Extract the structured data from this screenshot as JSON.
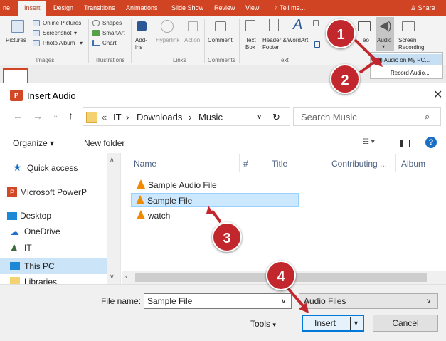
{
  "ribbon": {
    "tabs": [
      "ne",
      "Insert",
      "Design",
      "Transitions",
      "Animations",
      "Slide Show",
      "Review",
      "View",
      "Tell me...",
      "Share"
    ],
    "images": {
      "pictures": "Pictures",
      "online_pictures": "Online Pictures",
      "screenshot": "Screenshot",
      "photo_album": "Photo Album",
      "group": "Images"
    },
    "illustrations": {
      "shapes": "Shapes",
      "smartart": "SmartArt",
      "chart": "Chart",
      "group": "Illustrations"
    },
    "addins": {
      "label": "Add-ins"
    },
    "links": {
      "hyperlink": "Hyperlink",
      "action": "Action",
      "group": "Links"
    },
    "comments": {
      "comment": "Comment",
      "group": "Comments"
    },
    "text": {
      "text_box": "Text Box",
      "header_footer": "Header & Footer",
      "wordart": "WordArt",
      "group": "Text"
    },
    "media": {
      "video": "eo",
      "audio": "Audio",
      "screen_recording": "Screen Recording"
    },
    "audio_menu": {
      "on_pc": "Audio on My PC...",
      "record": "Record Audio..."
    }
  },
  "badges": [
    "1",
    "2",
    "3",
    "4"
  ],
  "dialog": {
    "title": "Insert Audio",
    "app_icon": "P",
    "breadcrumb": [
      "«",
      "IT",
      "›",
      "Downloads",
      "›",
      "Music"
    ],
    "search_placeholder": "Search Music",
    "organize": "Organize ▾",
    "new_folder": "New folder",
    "nav_items": [
      "Quick access",
      "Microsoft PowerP",
      "Desktop",
      "OneDrive",
      "IT",
      "This PC",
      "Libraries"
    ],
    "columns": [
      "Name",
      "#",
      "Title",
      "Contributing ...",
      "Album"
    ],
    "files": [
      "Sample Audio File",
      "Sample File",
      "watch"
    ],
    "selected_file": "Sample File",
    "file_name_label": "File name:",
    "file_name_value": "Sample File",
    "file_type": "Audio Files",
    "tools": "Tools",
    "insert": "Insert",
    "cancel": "Cancel"
  },
  "colors": {
    "ribbon_accent": "#d04423",
    "badge": "#c1272d",
    "selection": "#cce8ff"
  }
}
